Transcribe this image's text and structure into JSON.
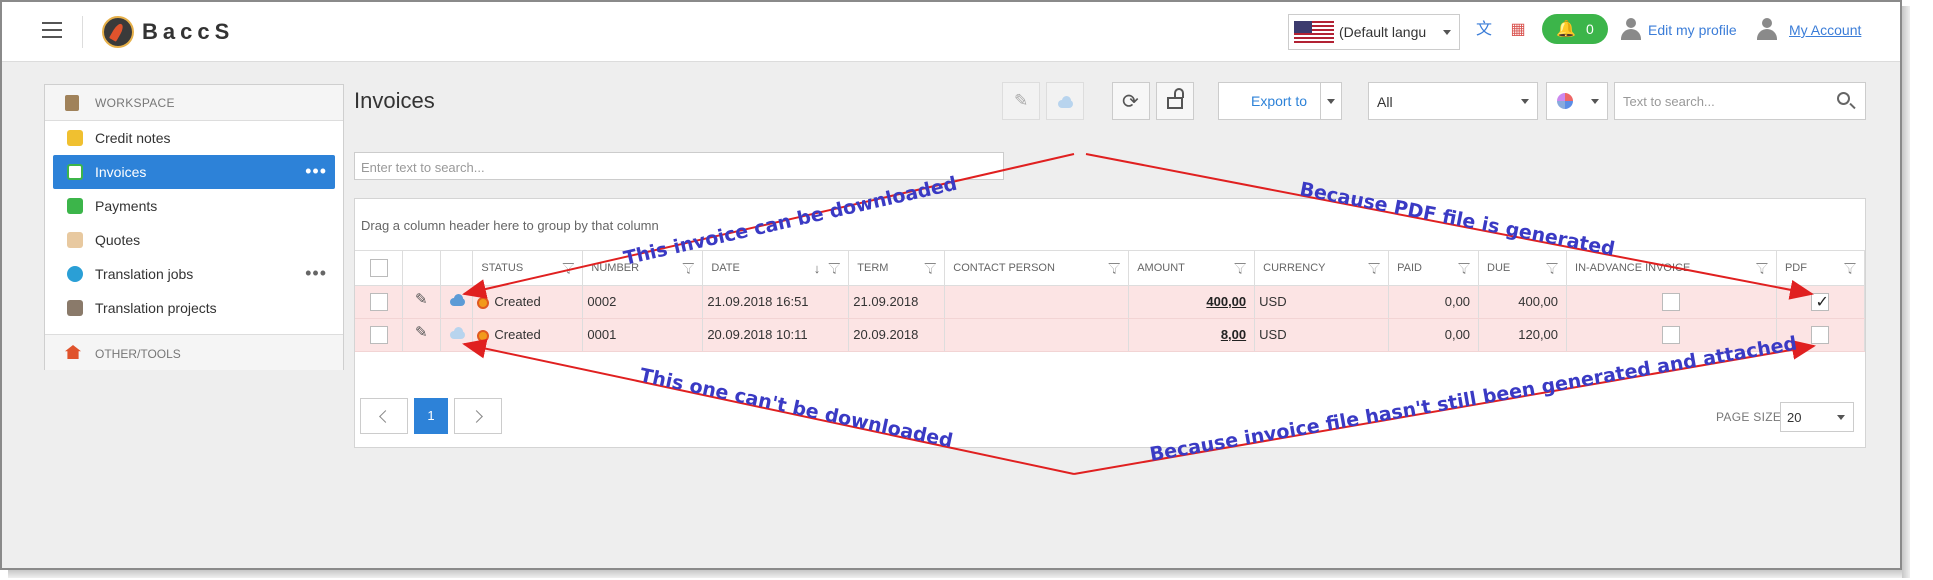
{
  "header": {
    "brand": "BaccS",
    "language": "(Default langu",
    "notifications_count": "0",
    "edit_profile": "Edit my profile",
    "my_account": "My Account"
  },
  "sidebar": {
    "workspace": "WORKSPACE",
    "items": [
      {
        "label": "Credit notes",
        "icon": "credit-notes-icon"
      },
      {
        "label": "Invoices",
        "icon": "invoice-icon",
        "active": true
      },
      {
        "label": "Payments",
        "icon": "payments-icon"
      },
      {
        "label": "Quotes",
        "icon": "quotes-icon"
      },
      {
        "label": "Translation jobs",
        "icon": "translation-jobs-icon"
      },
      {
        "label": "Translation projects",
        "icon": "translation-projects-icon"
      }
    ],
    "other_tools": "OTHER/TOOLS"
  },
  "page": {
    "title": "Invoices",
    "export_label": "Export to",
    "filter_value": "All",
    "search_placeholder": "Text to search...",
    "grid_search_placeholder": "Enter text to search...",
    "group_panel": "Drag a column header here to group by that column"
  },
  "grid": {
    "columns": [
      "STATUS",
      "NUMBER",
      "DATE",
      "TERM",
      "CONTACT PERSON",
      "AMOUNT",
      "CURRENCY",
      "PAID",
      "DUE",
      "IN-ADVANCE INVOICE",
      "PDF"
    ],
    "rows": [
      {
        "status": "Created",
        "number": "0002",
        "date": "21.09.2018 16:51",
        "term": "21.09.2018",
        "contact": "",
        "amount": "400,00",
        "currency": "USD",
        "paid": "0,00",
        "due": "400,00",
        "in_advance": false,
        "pdf": true
      },
      {
        "status": "Created",
        "number": "0001",
        "date": "20.09.2018 10:11",
        "term": "20.09.2018",
        "contact": "",
        "amount": "8,00",
        "currency": "USD",
        "paid": "0,00",
        "due": "120,00",
        "in_advance": false,
        "pdf": false
      }
    ]
  },
  "pager": {
    "current_page": "1",
    "page_size_label": "PAGE SIZE",
    "page_size": "20"
  },
  "annotations": {
    "can_download": "This invoice can be downloaded",
    "pdf_generated": "Because PDF file is generated",
    "cannot_download": "This one can't be downloaded",
    "not_generated": "Because invoice file hasn't still been generated and attached"
  },
  "colors": {
    "accent": "#2d82d8",
    "row_highlight": "#fce4e4",
    "annotation_text": "#3a3ac4",
    "annotation_arrow": "#e02020",
    "notification": "#3cb54a"
  }
}
